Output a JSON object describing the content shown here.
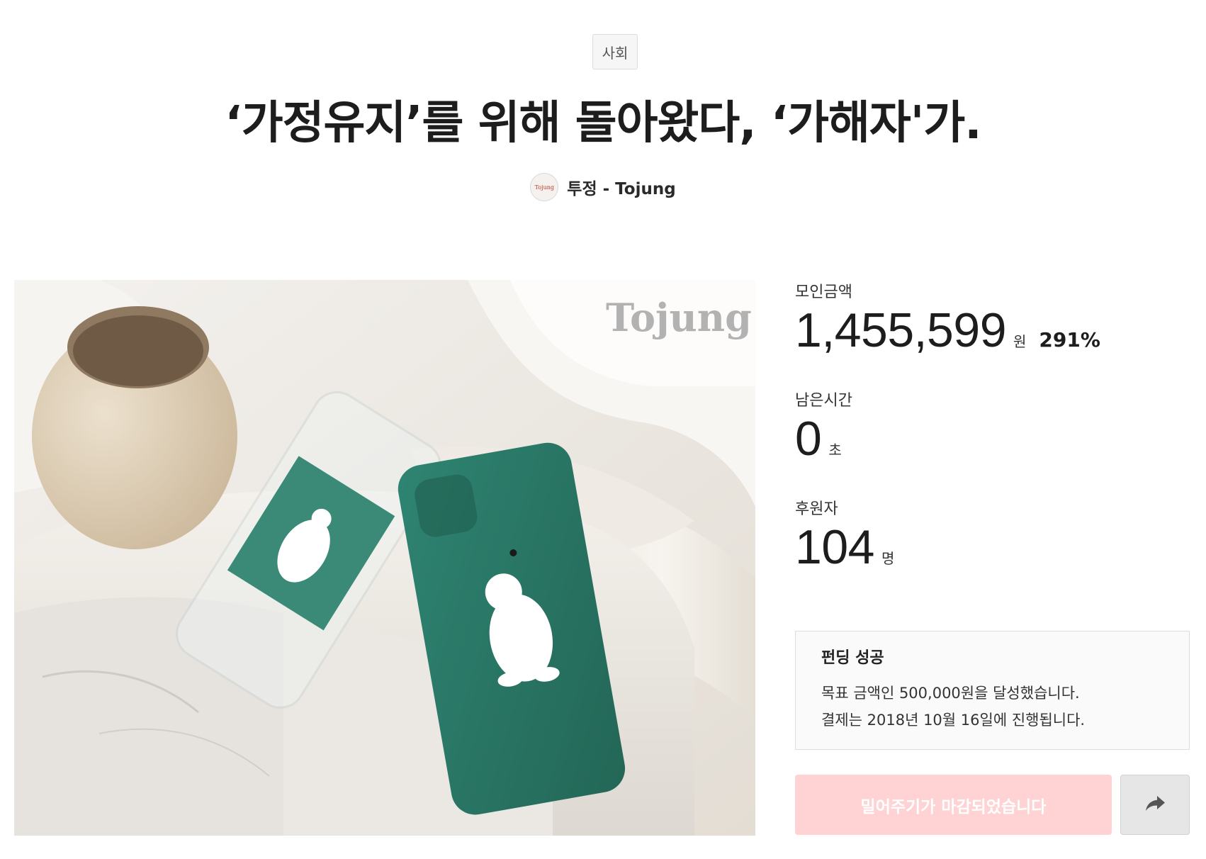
{
  "header": {
    "category": "사회",
    "title": "‘가정유지’를 위해 돌아왔다, ‘가해자'가.",
    "creator": {
      "avatar_text": "Tojung",
      "name": "투정 - Tojung"
    }
  },
  "hero": {
    "watermark": "Tojung"
  },
  "stats": {
    "amount": {
      "label": "모인금액",
      "value": "1,455,599",
      "unit": "원",
      "percent": "291%"
    },
    "time_left": {
      "label": "남은시간",
      "value": "0",
      "unit": "초"
    },
    "backers": {
      "label": "후원자",
      "value": "104",
      "unit": "명"
    }
  },
  "status_box": {
    "title": "펀딩 성공",
    "line1": "목표 금액인 500,000원을 달성했습니다.",
    "line2": "결제는 2018년 10월 16일에 진행됩니다."
  },
  "actions": {
    "closed_label": "밀어주기가 마감되었습니다",
    "share_icon": "share-arrow-icon"
  },
  "colors": {
    "closed_button_bg": "#ffd3d4",
    "phone_case_green": "#2f7d6b"
  }
}
